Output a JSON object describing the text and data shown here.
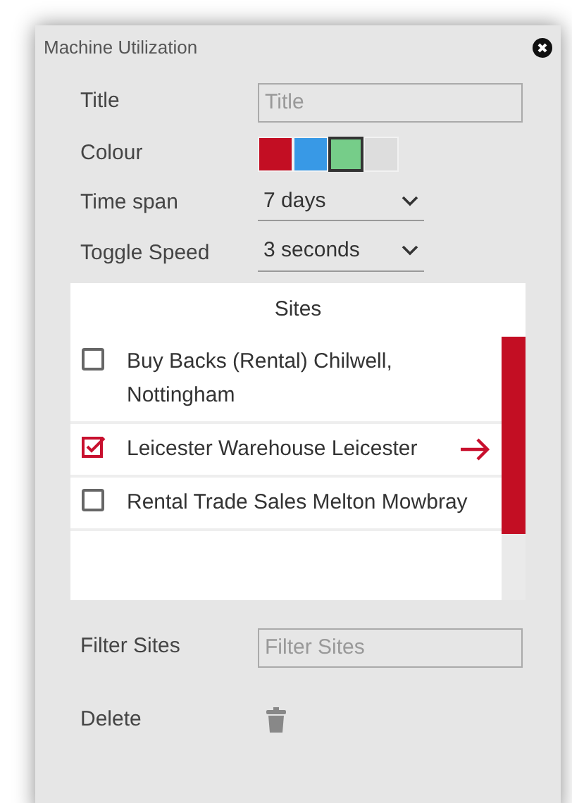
{
  "window": {
    "title": "Machine Utilization"
  },
  "title_field": {
    "label": "Title",
    "placeholder": "Title"
  },
  "colour": {
    "label": "Colour",
    "swatches": [
      {
        "color": "#c30e23",
        "selected": false
      },
      {
        "color": "#3899e6",
        "selected": false
      },
      {
        "color": "#76cd89",
        "selected": true
      },
      {
        "color": "#dddddd",
        "selected": false
      }
    ]
  },
  "time_span": {
    "label": "Time span",
    "value": "7 days"
  },
  "toggle_speed": {
    "label": "Toggle Speed",
    "value": "3 seconds"
  },
  "sites": {
    "heading": "Sites",
    "items": [
      {
        "name": "Buy Backs (Rental) Chilwell, Nottingham",
        "checked": false,
        "selected": false
      },
      {
        "name": "Leicester Warehouse Leicester",
        "checked": true,
        "selected": true
      },
      {
        "name": "Rental Trade Sales Melton Mowbray",
        "checked": false,
        "selected": false
      }
    ]
  },
  "filter": {
    "label": "Filter Sites",
    "placeholder": "Filter Sites"
  },
  "delete": {
    "label": "Delete"
  }
}
